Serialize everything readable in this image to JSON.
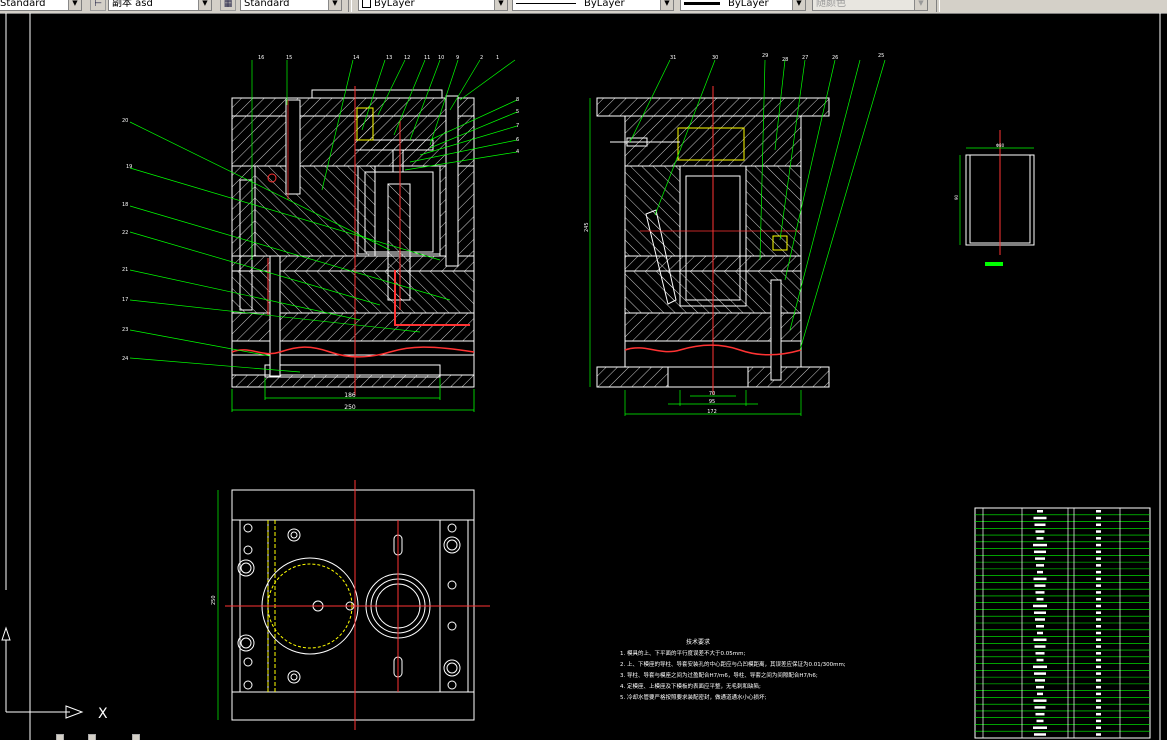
{
  "toolbar": {
    "text_style": "Standard",
    "dim_style": "副本 asd",
    "table_style": "Standard",
    "layer": "ByLayer",
    "linetype": "ByLayer",
    "lineweight": "ByLayer",
    "plot_style": "随颜色"
  },
  "drawing": {
    "front_view": {
      "part_numbers_top": [
        "16",
        "15",
        "14",
        "13",
        "12",
        "11",
        "10",
        "9",
        "2",
        "1"
      ],
      "part_numbers_right": [
        "8",
        "5",
        "7",
        "6",
        "4"
      ],
      "part_numbers_left": [
        "20",
        "19",
        "18",
        "22",
        "21",
        "17",
        "23",
        "24"
      ],
      "dim_inner": "186",
      "dim_outer": "250"
    },
    "side_view": {
      "part_numbers_top": [
        "31",
        "30",
        "29",
        "28",
        "27",
        "26",
        "25"
      ],
      "dim_height": "245",
      "dim_1": "70",
      "dim_2": "95",
      "dim_3": "172"
    },
    "part_detail": {
      "dim_top": "Φ80",
      "dim_side": "90"
    },
    "plan_view": {
      "dim_height": "250"
    },
    "tech_requirements": {
      "title": "技术要求",
      "items": [
        "1. 模具的上、下平面的平行度误差不大于0.05mm;",
        "2. 上、下模座的导柱、导套安装孔的中心距应与凸凹模距离，其误差应保证为0.01/300mm;",
        "3. 导柱、导套与模座之间为过盈配合H7/m6，导柱、导套之间为间隙配合H7/h6;",
        "4. 定模座、上模座及下模板的表面应平整，无毛刺和缺陷;",
        "5. 冷却水管要严格按照要求装配密封，做通道通水小心损坏;"
      ]
    }
  }
}
